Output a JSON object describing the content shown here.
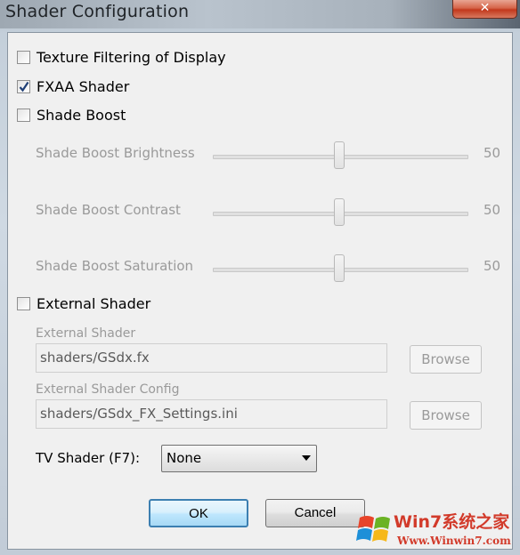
{
  "window": {
    "title": "Shader Configuration",
    "close_glyph": "✕"
  },
  "options": {
    "texture_filtering": {
      "label": "Texture Filtering of Display",
      "checked": false
    },
    "fxaa": {
      "label": "FXAA Shader",
      "checked": true
    },
    "shade_boost": {
      "label": "Shade Boost",
      "checked": false
    }
  },
  "sliders": [
    {
      "label": "Shade Boost Brightness",
      "value": "50",
      "position": 0.5
    },
    {
      "label": "Shade Boost Contrast",
      "value": "50",
      "position": 0.5
    },
    {
      "label": "Shade Boost Saturation",
      "value": "50",
      "position": 0.5
    }
  ],
  "external": {
    "checkbox_label": "External Shader",
    "checked": false,
    "shader_label": "External Shader",
    "shader_value": "shaders/GSdx.fx",
    "config_label": "External Shader Config",
    "config_value": "shaders/GSdx_FX_Settings.ini",
    "browse_label": "Browse"
  },
  "tv_shader": {
    "label": "TV Shader (F7):",
    "selected": "None"
  },
  "buttons": {
    "ok": "OK",
    "cancel": "Cancel"
  },
  "watermark": {
    "line1": "Win7系统之家",
    "line2": "Www.Winwin7.com"
  },
  "colors": {
    "disabled_text": "#9a9a9a",
    "ok_border": "#3c7fb1",
    "close_red": "#c2381c"
  }
}
